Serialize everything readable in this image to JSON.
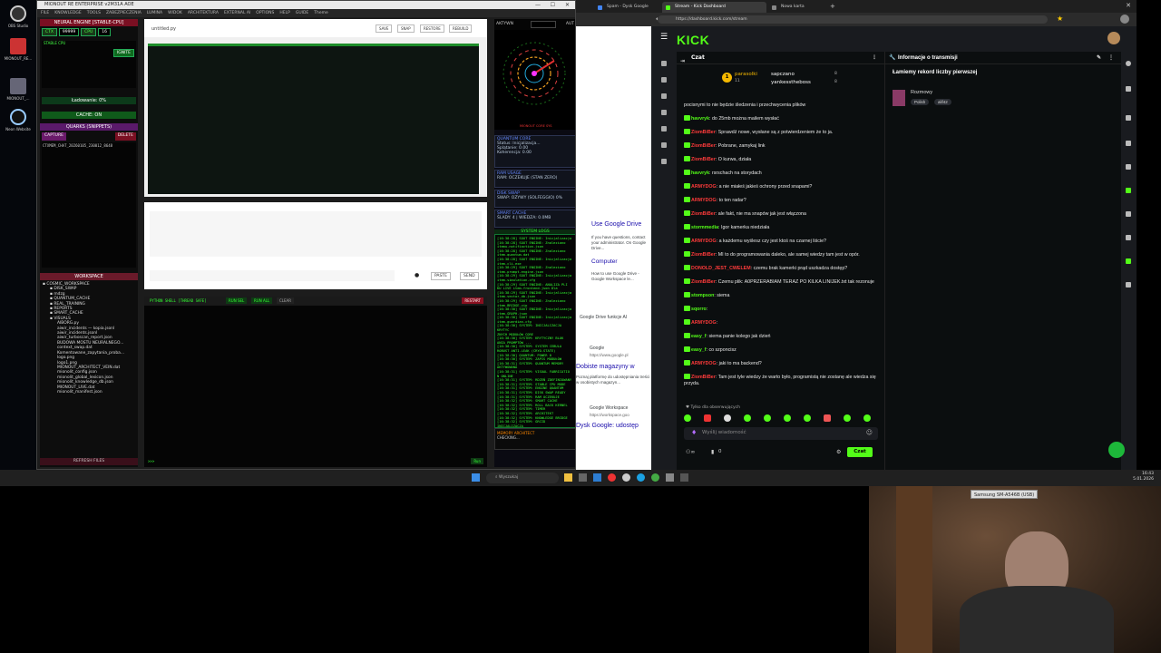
{
  "desktop": {
    "icons": [
      {
        "label": "OBS Studio"
      },
      {
        "label": "MIONOUT_RE..."
      },
      {
        "label": "MIONOUT_..."
      },
      {
        "label": "Neon Website"
      }
    ]
  },
  "ide": {
    "title": "MIONOUT RE ENTERPRISE v2M31A AOE",
    "menu": [
      "FILE",
      "KNOWLEDGE",
      "TOOLS",
      "ZABEZPIECZENIA",
      "LUMINA",
      "WIDOK",
      "ARCHITEKTURA",
      "EXTERNAL AI",
      "OPTIONS",
      "HELP",
      "GUIDE",
      "Theme"
    ],
    "left": {
      "engine_title": "NEURAL ENGINE [STABLE-CPU]",
      "ctx_label": "CTX",
      "ctx_value": "99999",
      "cpu_label": "CPU",
      "cpu_value": "16",
      "status": "STABLE CPU",
      "ignite": "IGNITE",
      "loaded": "Ładowanie: 0%",
      "cache": "CACHE: ON",
      "quarks_title": "QUARKS (SNIPPETS)",
      "capture": "CAPTURE",
      "delete": "DELETE",
      "snippet": "CTXMEM_CHAT_20260105_230012_8648",
      "workspace_title": "WORKSPACE",
      "tree": [
        "COSMIC_WORKSPACE",
        "DISK_SWAP",
        "mdzg",
        "QUANTUM_CACHE",
        "REAL_TRAINING",
        "REPORTS",
        "SMART_CACHE",
        "VISUALS",
        "AIBORG.py",
        "aiwir_incidents — kopia.jsonl",
        "aiwir_incidents.jsonl",
        "aiwir_turboscan_report.json",
        "BUDOWA MOSTU NEURALNEGO...",
        "context_swap.dat",
        "Komentowane_zapytania_proba...",
        "logo.png",
        "logo1.png",
        "MIONOUT_ARCHITECT_VEIN.dat",
        "mionolit_config.json",
        "mionolit_global_lexicon.json",
        "mionolit_knowledge_db.json",
        "MIONOUT_LIVE.dat",
        "mionolit_manifest.json"
      ],
      "refresh": "REFRESH FILES"
    },
    "editor": {
      "filename": "untitled.py",
      "save": "SAVE",
      "snap": "SNAP",
      "restore": "RESTORE",
      "rebuild": "REBUILD"
    },
    "input": {
      "paste": "PASTE",
      "send": "SEND"
    },
    "shell": {
      "title": "PYTHON SHELL [THREAD SAFE]",
      "run_sel": "RUN SEL",
      "run_all": "RUN ALL",
      "clear": "CLEAR",
      "restart": "RESTART",
      "prompt": ">>>",
      "run": "Run"
    },
    "right": {
      "aktyw": "AKTYWN",
      "aut": "AUT",
      "radar_caption": "MIONOUT CORE SYS",
      "quantum": {
        "title": "QUANTUM CORE",
        "status": "Status: Inicjalizacja...",
        "splatanie": "Splątanie: 0.00",
        "koherencja": "Koherencja: 0.00"
      },
      "ram": {
        "title": "RAM USAGE",
        "text": "RAM: OCZEKUJE (STAN ZERO)"
      },
      "disk": {
        "title": "DISK SWAP",
        "text": "SWAP: OZYWY (SOLFEGGIO) 0%"
      },
      "smart": {
        "title": "SMART CACHE",
        "text": "ŚLADY: 4 | WIEDZA: 0.0MB"
      },
      "logs_title": "SYSTEM LOGS",
      "logs": [
        "[16:38:28] SOUT ENGINE: Inicjalizacja",
        "[16:38:28] SOUT ENGINE: Znaleziono",
        "itemu-notifiaction.json",
        "[16:38:28] SOUT ENGINE: Znaleziono",
        "item-quantum.dat",
        "[16:38:28] SOUT ENGINE: Inicjalizacja",
        "item-cli.exe",
        "[16:38:29] SOUT ENGINE: Znaleziono",
        "item-prompt-engine.json",
        "[16:38:29] SOUT ENGINE: Inicjalizacja",
        "item-simulation.cfg",
        "[16:38:29] SOUT ENGINE: ANALIZA PLI",
        "KU LIVE item-frontend.json Dla",
        "[16:38:29] SOUT ENGINE: Inicjalizacja",
        "item-vector_db.json",
        "[16:38:29] SOUT ENGINE: Znaleziono",
        "item-BRIDGE.zip",
        "[16:38:30] SOUT ENGINE: Inicjalizacja",
        "item-GRAPH.json",
        "[16:38:30] SOUT ENGINE: Inicjalizacja",
        "item-guardian.cfg",
        "[16:38:30] SYSTEM: INICJALIZACJA KRYTYC",
        "ZNYCH MODUŁÓW CORE",
        "[16:38:30] SYSTEM: KRYTYCZNY BLOK",
        "ANIA PROMPTÓW ...",
        "[16:38:30] SYSTEM: SYSTEM CEBULA",
        "ROBUST ANTI-LEAK (CRYO-STATE)",
        "[16:38:30] QUANTUM: POWER 0",
        "[16:38:30] SYSTEM: ZAPIS MODUŁÓW",
        "[16:38:31] SYSTEM: QUANTUM MEMORY",
        "AKTYWOWANA",
        "[16:38:31] SYSTEM: VISUAL FABRICATIO",
        "N ONLINE",
        "[16:38:31] SYSTEM: RDZEŃ ZDEFINIOWANY",
        "[16:38:31] SYSTEM: STABLE CPU MODE",
        "[16:38:31] SYSTEM: ENGINE QUANTUM",
        "[16:38:31] SYSTEM: DISK SWAP READY",
        "[16:38:31] SYSTEM: RAM OCZEKUJE",
        "[16:38:32] SYSTEM: SMART CACHE",
        "[16:38:32] SYSTEM: ROLL BACK KERNEL",
        "[16:38:32] SYSTEM: TIMER",
        "[16:38:32] SYSTEM: ARCHITEKT",
        "[16:38:32] SYSTEM: KNOWLEDGE BRIDGE",
        "[16:38:32] SYSTEM: GRCID INICJALIZACJA",
        "[16:38:33] SYSTEM: FREEDOM & LOGIC",
        "CONTROLLER READY..."
      ],
      "memory_title": "MEMORY ARCHITECT",
      "memory_text": "CHECKING..."
    }
  },
  "browser": {
    "tabs": [
      {
        "label": "Spam - Dysk Google"
      },
      {
        "label": "Stream - Kick Dashboard"
      },
      {
        "label": "Nowa karta"
      }
    ],
    "url": "https://dashboard.kick.com/stream",
    "google_page": {
      "items": [
        "Use Google Drive",
        "If you have questions, contact your administrator. On Google Drive...",
        "Computer",
        "How to use Google Drive - Google Workspace le...",
        "Google Drive funkcje AI",
        "Google",
        "https://www.google.pl",
        "Dobiste magazyny w",
        "Poznaj platformę do udostępniania treści w osobistych magazyn...",
        "Google Workspace",
        "https://workspace.goo",
        "Dysk Google: udostęp"
      ]
    },
    "kick": {
      "logo": "KICK",
      "chat_title": "Czat",
      "leaderboard": [
        {
          "rank": "1",
          "name": "parasolki",
          "count": "11"
        },
        {
          "rank": "",
          "name": "sapczano",
          "count": "8"
        },
        {
          "rank": "",
          "name": "yankesstheboss",
          "count": "8"
        }
      ],
      "messages": [
        {
          "user": "",
          "text": "pocisnymi to nie będzie śledzenia i przechwycenia plików",
          "color": "#cfcfcf"
        },
        {
          "user": "havvryk",
          "text": ": do 25mb można mailem wysłać",
          "color": "#53fc18"
        },
        {
          "user": "ZiomBiBer",
          "text": ": Sprawdź nowe, wysłane są z potwierdzeniem że to ja.",
          "color": "#ff3b3b"
        },
        {
          "user": "ZiomBiBer",
          "text": ": Pobrane, zamykaj link",
          "color": "#ff3b3b"
        },
        {
          "user": "ZiomBiBer",
          "text": ": O kurwa, działa",
          "color": "#ff3b3b"
        },
        {
          "user": "havvryk",
          "text": ": rsrschach na storydach",
          "color": "#53fc18"
        },
        {
          "user": "ARMYDOG",
          "text": ": a nie miałeś jakieś ochrony przed snapami?",
          "color": "#ff3b3b"
        },
        {
          "user": "ARMYDOG",
          "text": ": to ten radar?",
          "color": "#ff3b3b"
        },
        {
          "user": "ZiomBiBer",
          "text": ": ale fakt, nie ma snapów jak jest włączona",
          "color": "#ff3b3b"
        },
        {
          "user": "stormmedia",
          "text": ": Igor kamerka niedziała",
          "color": "#53fc18"
        },
        {
          "user": "ARMYDOG",
          "text": ": a każdemu wyślesz czy jest ktoś na czarnej liście?",
          "color": "#ff3b3b"
        },
        {
          "user": "ZiomBiBer",
          "text": ": MI to do programowania daleko, ale samej wiedzy tam jest w opór.",
          "color": "#ff3b3b"
        },
        {
          "user": "DONOLD_JEST_CWELEM",
          "text": ": czemu brak kamerki prąd uszkadza dostęp?",
          "color": "#ff3b3b"
        },
        {
          "user": "ZiomBiBer",
          "text": ": Czemu plik: A0PRZERABIAM TERAZ PO KILKA LINIJEK.txt tak rezonuje",
          "color": "#ff3b3b"
        },
        {
          "user": "stompson",
          "text": ": siema",
          "color": "#53fc18"
        },
        {
          "user": "sqorro",
          "text": ":",
          "color": "#53fc18"
        },
        {
          "user": "ARMYDOG",
          "text": ":",
          "color": "#ff3b3b"
        },
        {
          "user": "easy_f",
          "text": ": siema panie kolego jak dzień",
          "color": "#53fc18"
        },
        {
          "user": "easy_f",
          "text": ": co szponcisz",
          "color": "#53fc18"
        },
        {
          "user": "ARMYDOG",
          "text": ": jaki to ma backend?",
          "color": "#ff3b3b"
        },
        {
          "user": "ZiomBiBer",
          "text": ": Tam jest tyle wiedzy że warto było, programistą nie zostanę ale wiedza się przyda.",
          "color": "#ff3b3b"
        }
      ],
      "followers_only": "Tylko dla obserwujących",
      "input_placeholder": "Wyślij wiadomość",
      "viewers": "0",
      "chat_button": "Czat",
      "info_title": "Informacje o transmisji",
      "stream_title": "Łamiemy rekord liczby pierwszej",
      "category": "Rozmowy",
      "tags": [
        "Polish",
        "alif42"
      ]
    }
  },
  "taskbar": {
    "search": "Wyszukaj",
    "time": "16:43",
    "date": "5.01.2026"
  },
  "webcam": {
    "label": "Samsung SM-A546B (USB)"
  }
}
